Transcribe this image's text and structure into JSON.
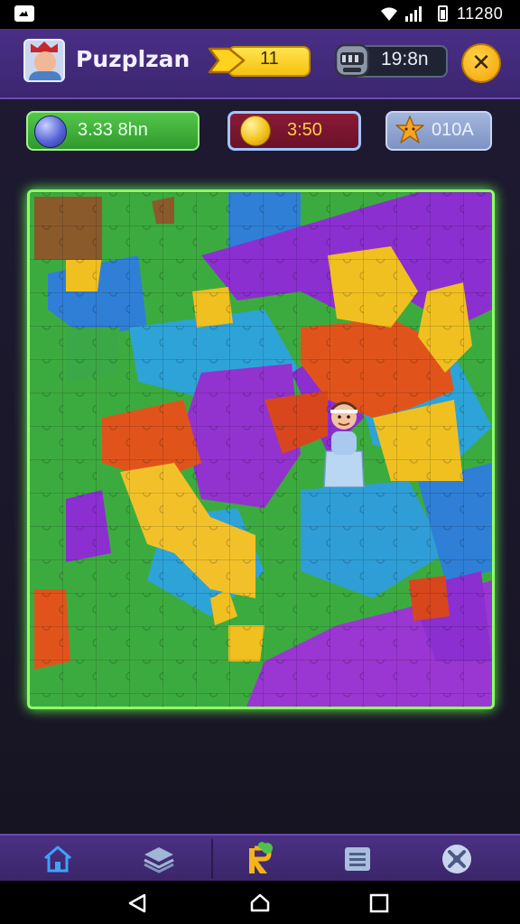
{
  "status_bar": {
    "time": "11280"
  },
  "header": {
    "title": "Puzplzan",
    "level_value": "11",
    "timer_value": "19:8n",
    "close_label": "✕"
  },
  "stats": {
    "gems": "3.33 8hn",
    "coins_timer": "3:50",
    "stars": "010A"
  },
  "colors": {
    "accent_green": "#8cff6a",
    "header_purple": "#4a2f86",
    "coin_gold": "#f3c31b"
  },
  "nav": {
    "items": [
      "home-icon",
      "layers-icon",
      "puzzle-icon",
      "list-icon",
      "tools-icon"
    ]
  },
  "system_nav": [
    "back-icon",
    "home-circle-icon",
    "recents-icon"
  ]
}
